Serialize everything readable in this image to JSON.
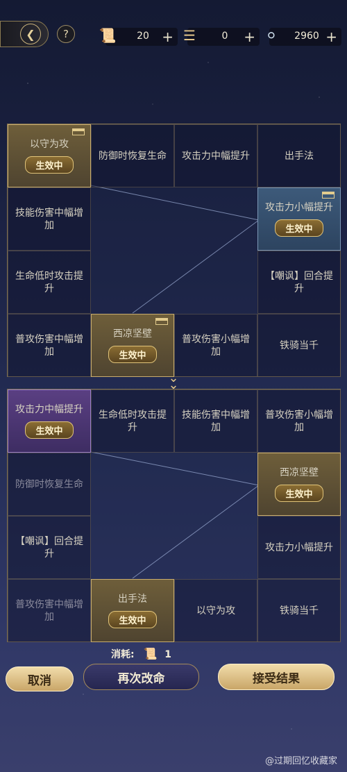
{
  "resources": [
    {
      "icon": "scroll-icon",
      "value": "20"
    },
    {
      "icon": "bamboo-slip-icon",
      "value": "0"
    },
    {
      "icon": "silver-orb-icon",
      "value": "2960"
    }
  ],
  "plus_label": "+",
  "help_label": "?",
  "active_tag": "生效中",
  "grid1": {
    "cells": [
      {
        "label": "以守为攻",
        "style": "gold",
        "active": true,
        "corner": true
      },
      {
        "label": "防御时恢复生命",
        "style": "normal"
      },
      {
        "label": "攻击力中幅提升",
        "style": "normal"
      },
      {
        "label": "出手法",
        "style": "normal"
      },
      {
        "label": "技能伤害中幅增加",
        "style": "normal"
      },
      {
        "label": "攻击力小幅提升",
        "style": "blue",
        "active": true,
        "corner": true
      },
      {
        "label": "生命低时攻击提升",
        "style": "normal"
      },
      {
        "label": "【嘲讽】回合提升",
        "style": "normal"
      },
      {
        "label": "普攻伤害中幅增加",
        "style": "normal"
      },
      {
        "label": "西凉坚壁",
        "style": "gold",
        "active": true,
        "corner": true
      },
      {
        "label": "普攻伤害小幅增加",
        "style": "normal"
      },
      {
        "label": "铁骑当千",
        "style": "normal"
      }
    ]
  },
  "grid2": {
    "cells": [
      {
        "label": "攻击力中幅提升",
        "style": "purple",
        "active": true
      },
      {
        "label": "生命低时攻击提升",
        "style": "normal"
      },
      {
        "label": "技能伤害中幅增加",
        "style": "normal"
      },
      {
        "label": "普攻伤害小幅增加",
        "style": "normal"
      },
      {
        "label": "防御时恢复生命",
        "style": "dim"
      },
      {
        "label": "西凉坚壁",
        "style": "gold",
        "active": true
      },
      {
        "label": "【嘲讽】回合提升",
        "style": "normal"
      },
      {
        "label": "攻击力小幅提升",
        "style": "normal"
      },
      {
        "label": "普攻伤害中幅增加",
        "style": "dim"
      },
      {
        "label": "出手法",
        "style": "gold",
        "active": true
      },
      {
        "label": "以守为攻",
        "style": "normal"
      },
      {
        "label": "铁骑当千",
        "style": "normal"
      }
    ]
  },
  "cost": {
    "label": "消耗:",
    "icon": "scroll-icon",
    "value": "1"
  },
  "buttons": {
    "cancel": "取消",
    "retry": "再次改命",
    "accept": "接受结果"
  },
  "watermark": "@过期回忆收藏家"
}
